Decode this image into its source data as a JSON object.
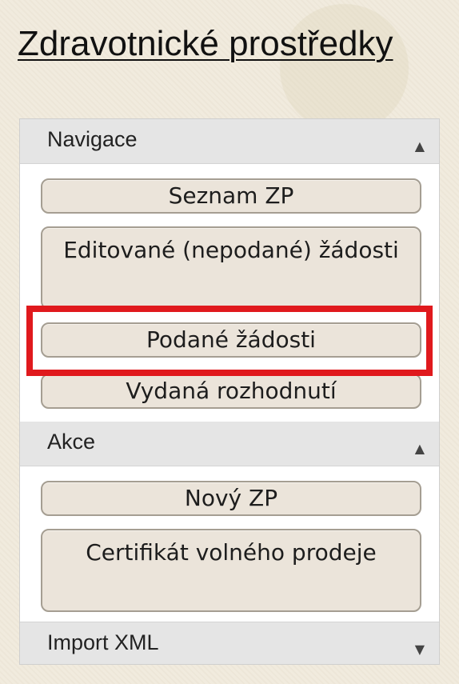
{
  "page": {
    "title": "Zdravotnické prostředky"
  },
  "sections": {
    "navigace": {
      "header": "Navigace",
      "collapse_icon": "triangle-up-icon",
      "buttons": [
        "Seznam ZP",
        "Editované (nepodané) žádosti",
        "Podané žádosti",
        "Vydaná rozhodnutí"
      ]
    },
    "akce": {
      "header": "Akce",
      "collapse_icon": "triangle-up-icon",
      "buttons": [
        "Nový ZP",
        "Certifikát volného prodeje"
      ]
    },
    "import_xml": {
      "header": "Import XML",
      "expand_icon": "triangle-down-icon"
    }
  },
  "highlight": {
    "color": "#e0191d",
    "target": "Podané žádosti"
  }
}
